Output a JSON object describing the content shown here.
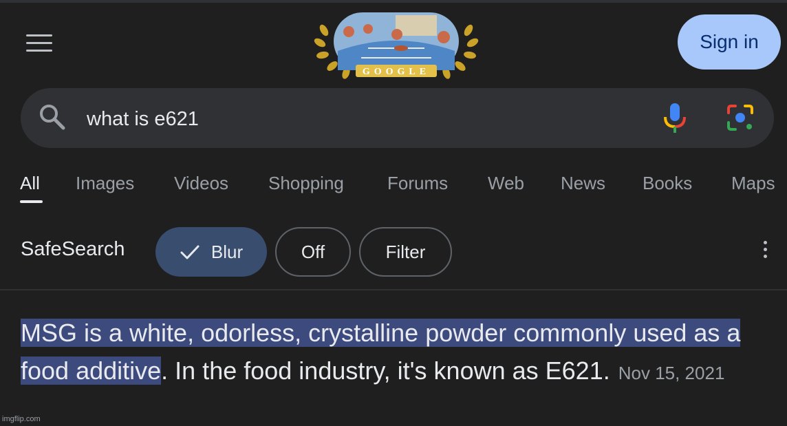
{
  "header": {
    "signin_label": "Sign in",
    "doodle_text": "GOOGLE"
  },
  "search": {
    "query": "what is e621"
  },
  "tabs": [
    {
      "label": "All",
      "active": true
    },
    {
      "label": "Images",
      "active": false
    },
    {
      "label": "Videos",
      "active": false
    },
    {
      "label": "Shopping",
      "active": false
    },
    {
      "label": "Forums",
      "active": false
    },
    {
      "label": "Web",
      "active": false
    },
    {
      "label": "News",
      "active": false
    },
    {
      "label": "Books",
      "active": false
    },
    {
      "label": "Maps",
      "active": false
    }
  ],
  "safesearch": {
    "label": "SafeSearch",
    "options": [
      "Blur",
      "Off",
      "Filter"
    ],
    "selected": "Blur"
  },
  "result": {
    "highlighted_text": "MSG is a white, odorless, crystalline powder commonly used as a food additive",
    "rest_text": ". In the food industry, it's known as E621.",
    "date": "Nov 15, 2021"
  },
  "watermark": "imgflip.com",
  "icons": {
    "menu": "menu-icon",
    "search": "search-icon",
    "mic": "mic-icon",
    "lens": "lens-icon",
    "check": "check-icon",
    "more": "more-vert-icon"
  },
  "colors": {
    "background": "#1f1f1f",
    "search_bar": "#303134",
    "signin_bg": "#a8c7fa",
    "signin_text": "#062e6f",
    "chip_selected": "#394d6f",
    "highlight": "#3d4a7d"
  }
}
